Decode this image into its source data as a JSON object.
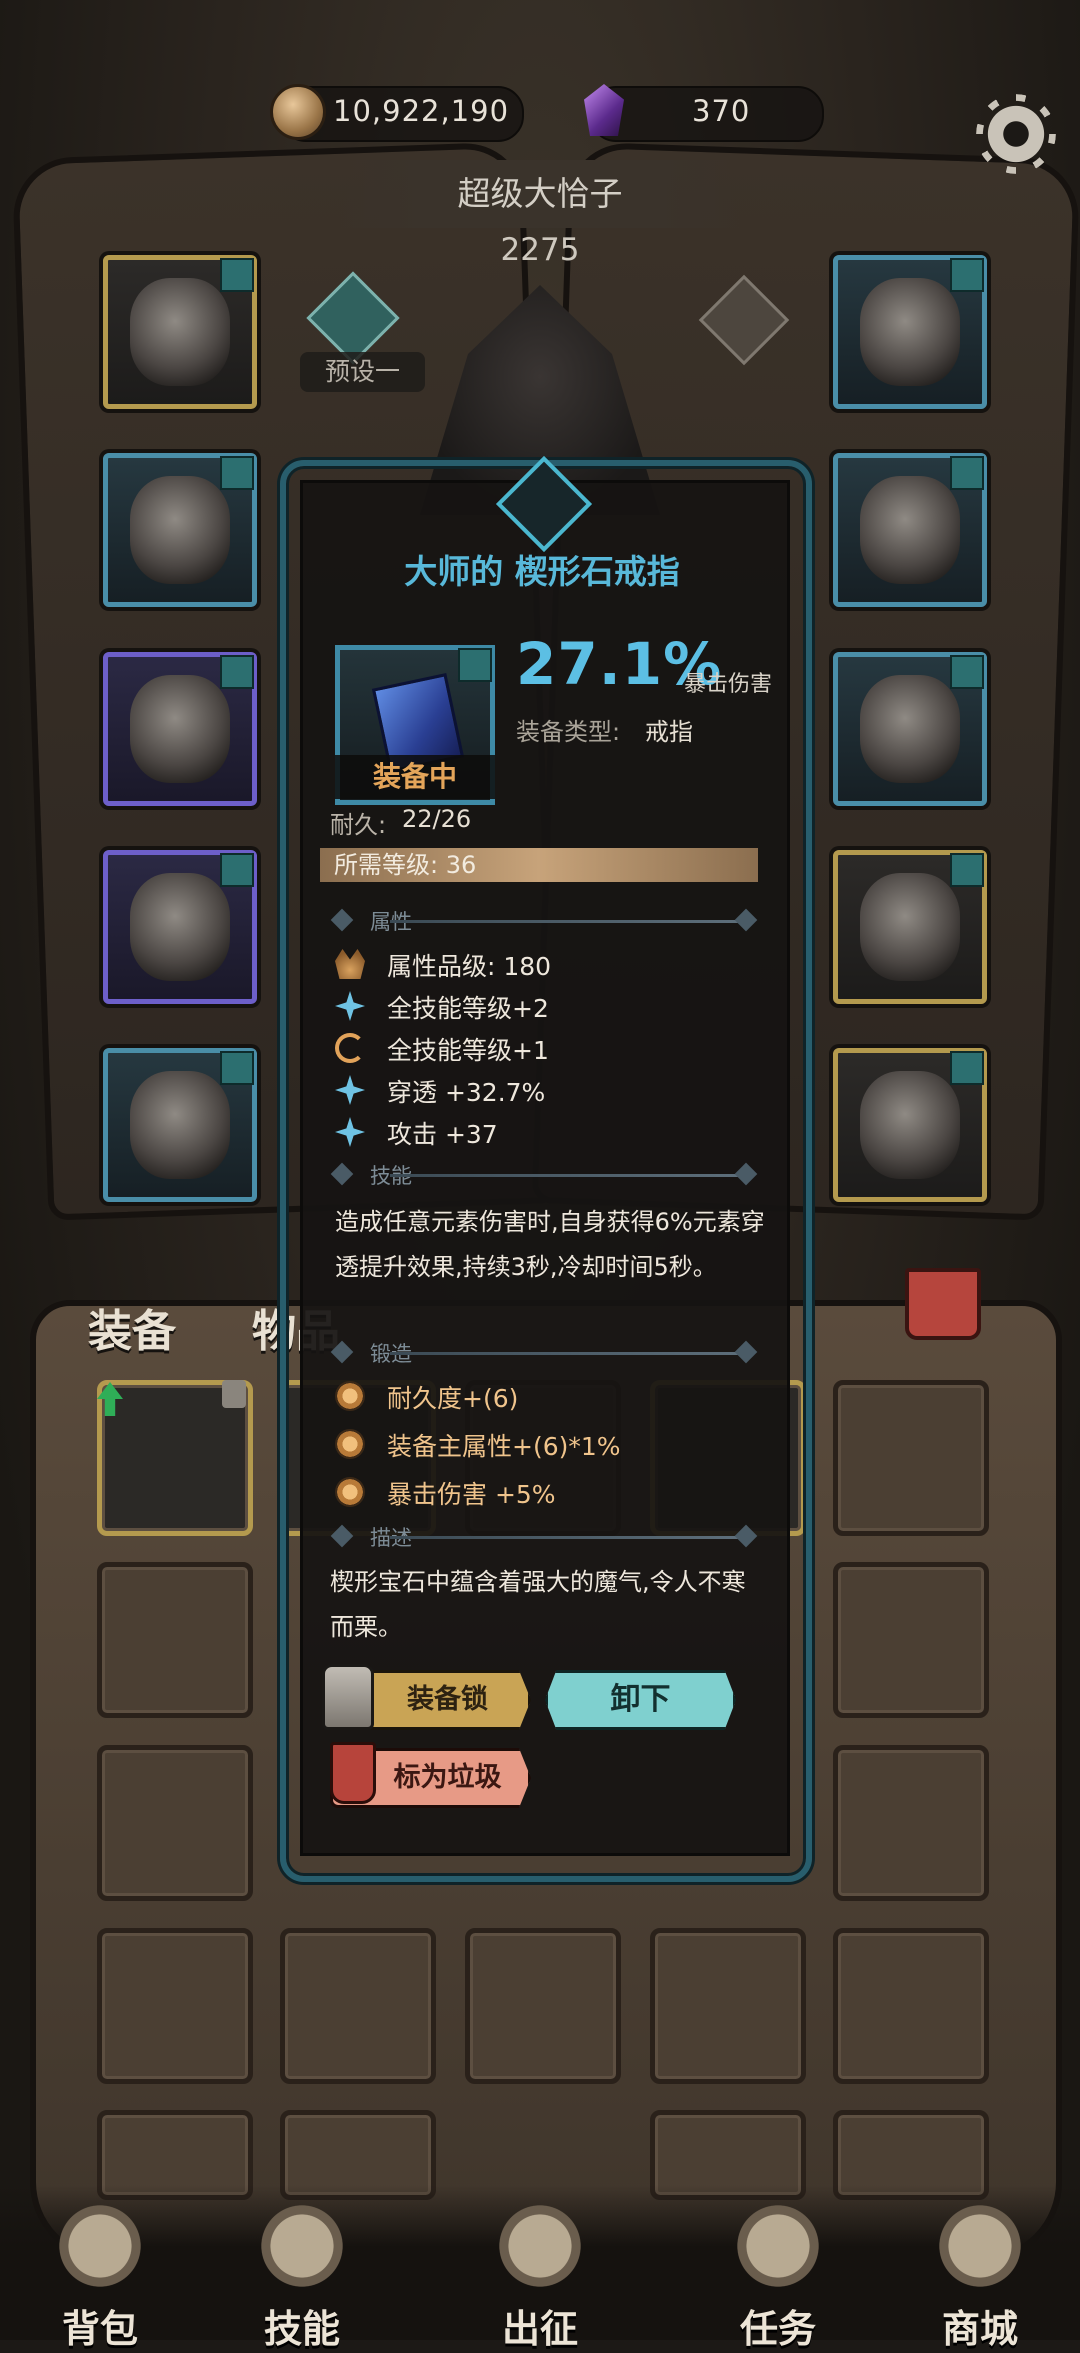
{
  "currency": {
    "gold_amount": "10,922,190",
    "gem_amount": "370"
  },
  "hero": {
    "name": "超级大恰子",
    "power": "2275",
    "preset_label": "预设一"
  },
  "tabs": {
    "equipment": "装备",
    "items": "物品"
  },
  "nav": {
    "items": [
      {
        "label": "背包",
        "icon": "backpack-icon"
      },
      {
        "label": "技能",
        "icon": "skill-book-icon"
      },
      {
        "label": "出征",
        "icon": "sword-scroll-icon"
      },
      {
        "label": "任务",
        "icon": "quest-horn-icon"
      },
      {
        "label": "商城",
        "icon": "shop-crown-icon"
      }
    ]
  },
  "popup": {
    "title": "大师的 楔形石戒指",
    "equipped_label": "装备中",
    "main_stat_value": "27.1%",
    "main_stat_name": "暴击伤害",
    "type_label": "装备类型:",
    "type_value": "戒指",
    "durability_label": "耐久:",
    "durability_value": "22/26",
    "required_level": "所需等级: 36",
    "sections": {
      "attributes": "属性",
      "skill": "技能",
      "forge": "锻造",
      "description": "描述"
    },
    "attributes": [
      {
        "icon": "crown-icon",
        "text": "属性品级: 180"
      },
      {
        "icon": "star-icon",
        "text": "全技能等级+2"
      },
      {
        "icon": "cycle-icon",
        "text": "全技能等级+1"
      },
      {
        "icon": "star-icon",
        "text": "穿透 +32.7%"
      },
      {
        "icon": "star-icon",
        "text": "攻击 +37"
      }
    ],
    "skill_text": "造成任意元素伤害时,自身获得6%元素穿透提升效果,持续3秒,冷却时间5秒。",
    "forge": [
      {
        "text": "耐久度+(6)"
      },
      {
        "text": "装备主属性+(6)*1%"
      },
      {
        "text": "暴击伤害 +5%"
      }
    ],
    "description": "楔形宝石中蕴含着强大的魔气,令人不寒而栗。",
    "buttons": {
      "lock": "装备锁",
      "unequip": "卸下",
      "mark_trash": "标为垃圾"
    }
  },
  "colors": {
    "accent_blue": "#5cbfe4",
    "equipped_orange": "#e4a55a",
    "unequip_teal": "#7fd0cf",
    "lock_gold": "#c9a455",
    "trash_pink": "#e79a86"
  }
}
